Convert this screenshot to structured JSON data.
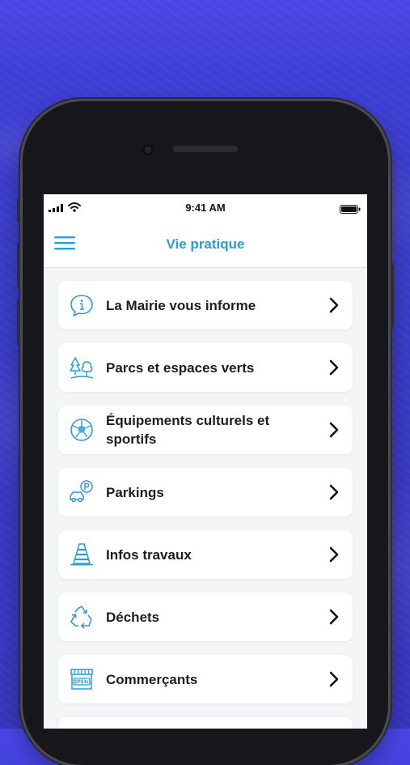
{
  "status_bar": {
    "time": "9:41 AM"
  },
  "header": {
    "title": "Vie pratique"
  },
  "menu_items": [
    {
      "label": "La Mairie vous informe",
      "icon": "info-bubble-icon"
    },
    {
      "label": "Parcs et espaces verts",
      "icon": "trees-icon"
    },
    {
      "label": "Équipements culturels et sportifs",
      "icon": "soccer-ball-icon"
    },
    {
      "label": "Parkings",
      "icon": "car-parking-icon"
    },
    {
      "label": "Infos travaux",
      "icon": "traffic-cone-icon"
    },
    {
      "label": "Déchets",
      "icon": "recycle-icon"
    },
    {
      "label": "Commerçants",
      "icon": "shop-icon"
    }
  ],
  "colors": {
    "accent": "#2e9bd8",
    "background": "#3a3cc9"
  }
}
